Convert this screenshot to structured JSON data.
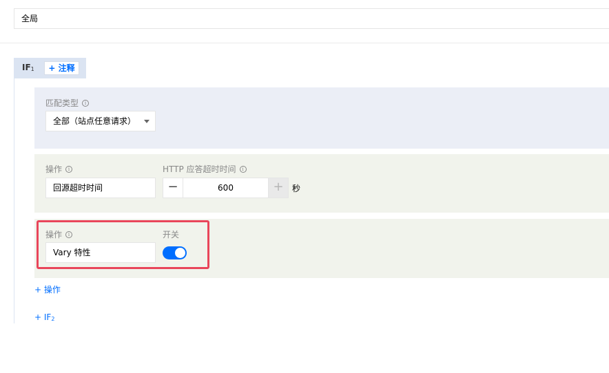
{
  "scope": {
    "value": "全局"
  },
  "if_block": {
    "label": "IF",
    "index": "1",
    "note_button": "+ 注释"
  },
  "match": {
    "label": "匹配类型",
    "value": "全部（站点任意请求）"
  },
  "action1": {
    "label": "操作",
    "value": "回源超时时间",
    "timeout_label": "HTTP 应答超时时间",
    "timeout_value": "600",
    "decrement": "−",
    "increment": "+",
    "unit": "秒"
  },
  "action2": {
    "label": "操作",
    "value": "Vary 特性",
    "switch_label": "开关",
    "switch_on": true
  },
  "add_action": "+ 操作",
  "add_if": {
    "prefix": "+ IF",
    "index": "2"
  },
  "colors": {
    "accent": "#006eff",
    "highlight": "#e9455a"
  },
  "icons": {
    "info": "info-icon",
    "caret": "caret-down-icon"
  }
}
